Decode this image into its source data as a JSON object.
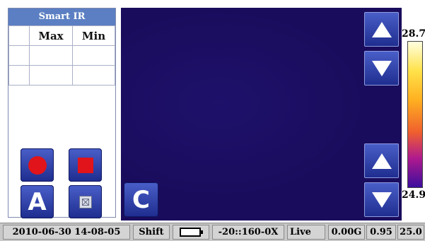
{
  "panel": {
    "title": "Smart IR",
    "headers": [
      "",
      "Max",
      "Min"
    ],
    "rows": [
      [
        "",
        "",
        ""
      ],
      [
        "",
        "",
        ""
      ]
    ]
  },
  "buttons": {
    "a_label": "A",
    "c_label": "C"
  },
  "scale": {
    "max": "28.7",
    "min": "24.9"
  },
  "status": {
    "datetime": "2010-06-30 14-08-05",
    "shift": "Shift",
    "range": "-20::160-0X",
    "mode": "Live",
    "gain": "0.00G",
    "emissivity": "0.95",
    "value": "25.0"
  },
  "colors": {
    "thermal_bg": "#1a0c5c",
    "button": "#2f44b0",
    "record_red": "#e0141a"
  },
  "icons": [
    "record-icon",
    "stop-icon",
    "image-icon",
    "arrow-up-icon",
    "arrow-down-icon",
    "battery-icon"
  ]
}
